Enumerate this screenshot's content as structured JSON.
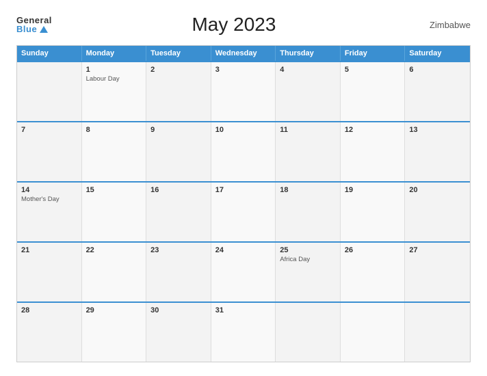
{
  "header": {
    "logo_general": "General",
    "logo_blue": "Blue",
    "title": "May 2023",
    "country": "Zimbabwe"
  },
  "days_of_week": [
    "Sunday",
    "Monday",
    "Tuesday",
    "Wednesday",
    "Thursday",
    "Friday",
    "Saturday"
  ],
  "weeks": [
    [
      {
        "day": "",
        "holiday": ""
      },
      {
        "day": "1",
        "holiday": "Labour Day"
      },
      {
        "day": "2",
        "holiday": ""
      },
      {
        "day": "3",
        "holiday": ""
      },
      {
        "day": "4",
        "holiday": ""
      },
      {
        "day": "5",
        "holiday": ""
      },
      {
        "day": "6",
        "holiday": ""
      }
    ],
    [
      {
        "day": "7",
        "holiday": ""
      },
      {
        "day": "8",
        "holiday": ""
      },
      {
        "day": "9",
        "holiday": ""
      },
      {
        "day": "10",
        "holiday": ""
      },
      {
        "day": "11",
        "holiday": ""
      },
      {
        "day": "12",
        "holiday": ""
      },
      {
        "day": "13",
        "holiday": ""
      }
    ],
    [
      {
        "day": "14",
        "holiday": "Mother's Day"
      },
      {
        "day": "15",
        "holiday": ""
      },
      {
        "day": "16",
        "holiday": ""
      },
      {
        "day": "17",
        "holiday": ""
      },
      {
        "day": "18",
        "holiday": ""
      },
      {
        "day": "19",
        "holiday": ""
      },
      {
        "day": "20",
        "holiday": ""
      }
    ],
    [
      {
        "day": "21",
        "holiday": ""
      },
      {
        "day": "22",
        "holiday": ""
      },
      {
        "day": "23",
        "holiday": ""
      },
      {
        "day": "24",
        "holiday": ""
      },
      {
        "day": "25",
        "holiday": "Africa Day"
      },
      {
        "day": "26",
        "holiday": ""
      },
      {
        "day": "27",
        "holiday": ""
      }
    ],
    [
      {
        "day": "28",
        "holiday": ""
      },
      {
        "day": "29",
        "holiday": ""
      },
      {
        "day": "30",
        "holiday": ""
      },
      {
        "day": "31",
        "holiday": ""
      },
      {
        "day": "",
        "holiday": ""
      },
      {
        "day": "",
        "holiday": ""
      },
      {
        "day": "",
        "holiday": ""
      }
    ]
  ]
}
